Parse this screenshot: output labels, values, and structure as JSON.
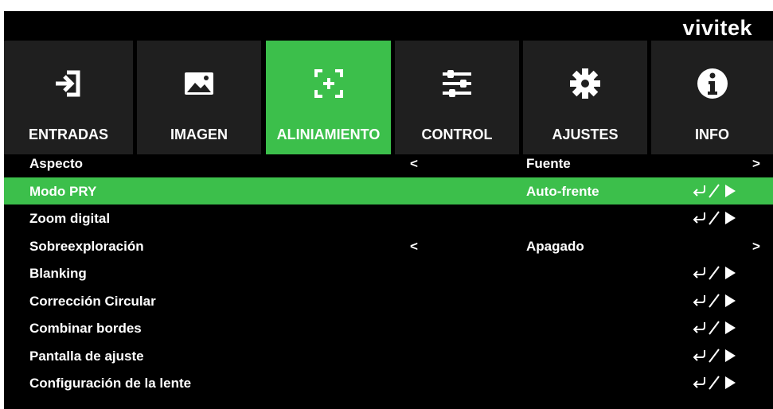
{
  "brand": "vivitek",
  "tabs": [
    {
      "label": "ENTRADAS",
      "icon": "input-icon",
      "active": false
    },
    {
      "label": "IMAGEN",
      "icon": "image-icon",
      "active": false
    },
    {
      "label": "ALINIAMIENTO",
      "icon": "alignment-icon",
      "active": true
    },
    {
      "label": "CONTROL",
      "icon": "sliders-icon",
      "active": false
    },
    {
      "label": "AJUSTES",
      "icon": "gear-icon",
      "active": false
    },
    {
      "label": "INFO",
      "icon": "info-icon",
      "active": false
    }
  ],
  "menu": {
    "rows": [
      {
        "label": "Aspecto",
        "value": "Fuente",
        "left_arrow": "<",
        "right_arrow": ">",
        "type": "selector",
        "selected": false
      },
      {
        "label": "Modo PRY",
        "value": "Auto-frente",
        "type": "enter",
        "selected": true
      },
      {
        "label": "Zoom digital",
        "type": "enter",
        "selected": false
      },
      {
        "label": "Sobreexploración",
        "value": "Apagado",
        "left_arrow": "<",
        "right_arrow": ">",
        "type": "selector",
        "selected": false
      },
      {
        "label": "Blanking",
        "type": "enter",
        "selected": false
      },
      {
        "label": "Corrección Circular",
        "type": "enter",
        "selected": false
      },
      {
        "label": "Combinar bordes",
        "type": "enter",
        "selected": false
      },
      {
        "label": "Pantalla de ajuste",
        "type": "enter",
        "selected": false
      },
      {
        "label": "Configuración de la lente",
        "type": "enter",
        "selected": false
      }
    ]
  },
  "colors": {
    "accent": "#3cbf4b",
    "background": "#000000",
    "tab_inactive": "#1f1f1f",
    "text": "#ffffff"
  }
}
